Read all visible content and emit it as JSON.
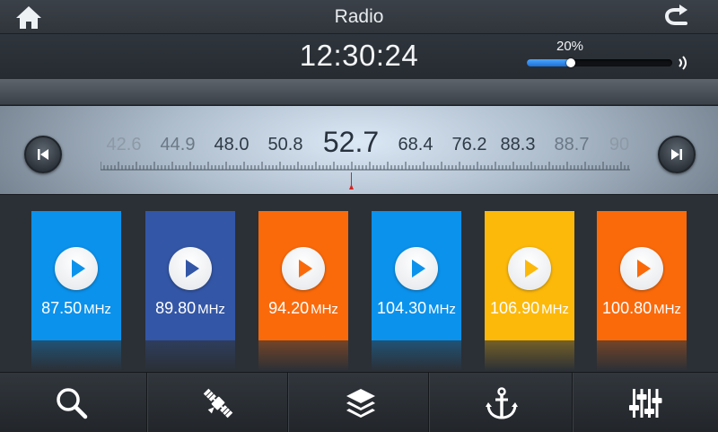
{
  "header": {
    "title": "Radio",
    "home_icon": "home-icon",
    "back_icon": "back-arrow-icon"
  },
  "status": {
    "clock": "12:30:24",
    "volume_label": "20%",
    "volume_level": 0.3,
    "speaker_icon": "speaker-icon"
  },
  "tuner": {
    "frequencies": [
      "42.6",
      "44.9",
      "48.0",
      "50.8",
      "52.7",
      "68.4",
      "76.2",
      "88.3",
      "88.7",
      "90"
    ],
    "active_frequency": "52.7",
    "prev_icon": "skip-previous-icon",
    "next_icon": "skip-next-icon"
  },
  "presets": [
    {
      "value": "87.50",
      "unit": "MHz",
      "color": "#0b92ec"
    },
    {
      "value": "89.80",
      "unit": "MHz",
      "color": "#3356a6"
    },
    {
      "value": "94.20",
      "unit": "MHz",
      "color": "#fb6a0a"
    },
    {
      "value": "104.30",
      "unit": "MHz",
      "color": "#0b92ec"
    },
    {
      "value": "106.90",
      "unit": "MHz",
      "color": "#fdb90a"
    },
    {
      "value": "100.80",
      "unit": "MHz",
      "color": "#fb6a0a"
    }
  ],
  "toolbar": {
    "items": [
      {
        "icon": "search-icon"
      },
      {
        "icon": "satellite-icon"
      },
      {
        "icon": "layers-icon"
      },
      {
        "icon": "anchor-icon"
      },
      {
        "icon": "equalizer-icon"
      }
    ]
  },
  "colors": {
    "accent": "#2f87e8",
    "needle": "#d8231e"
  }
}
